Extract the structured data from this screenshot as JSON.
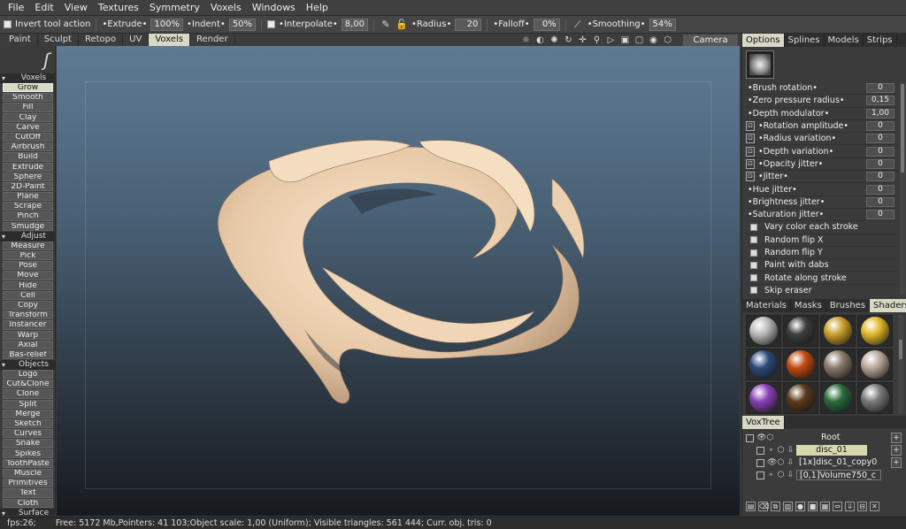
{
  "menu": [
    "File",
    "Edit",
    "View",
    "Textures",
    "Symmetry",
    "Voxels",
    "Windows",
    "Help"
  ],
  "toolopts": {
    "invert": "Invert tool action",
    "extrude_label": "•Extrude•",
    "extrude": "100%",
    "indent_label": "•Indent•",
    "indent": "50%",
    "interp_label": "•Interpolate•",
    "interp": "8,00",
    "radius_label": "•Radius•",
    "radius": "20",
    "falloff_label": "•Falloff•",
    "falloff": "0%",
    "smoothing_label": "•Smoothing•",
    "smoothing": "54%"
  },
  "rooms": [
    "Paint",
    "Sculpt",
    "Retopo",
    "UV",
    "Voxels",
    "Render"
  ],
  "camera": "Camera",
  "left": {
    "voxels_header": "Voxels",
    "voxels": [
      "Grow",
      "Smooth",
      "Fill",
      "Clay",
      "Carve",
      "CutOff",
      "Airbrush",
      "Build",
      "Extrude",
      "Sphere",
      "2D-Paint",
      "Plane",
      "Scrape",
      "Pinch",
      "Smudge"
    ],
    "adjust_header": "Adjust",
    "adjust": [
      "Measure",
      "Pick",
      "Pose",
      "Move",
      "Hide",
      "Cell",
      "Copy",
      "Transform",
      "Instancer",
      "Warp",
      "Axial",
      "Bas-relief"
    ],
    "objects_header": "Objects",
    "objects": [
      "Logo",
      "Cut&Clone",
      "Clone",
      "Split",
      "Merge",
      "Sketch",
      "Curves",
      "Snake",
      "Spikes",
      "ToothPaste",
      "Muscle",
      "Primitives",
      "Text",
      "Cloth"
    ],
    "surface_header": "Surface"
  },
  "right": {
    "tabs": [
      "Options",
      "Splines",
      "Models",
      "Strips"
    ],
    "options": [
      {
        "name": "•Brush rotation•",
        "val": "0",
        "lock": false
      },
      {
        "name": "•Zero pressure radius•",
        "val": "0,15",
        "lock": false
      },
      {
        "name": "•Depth modulator•",
        "val": "1,00",
        "lock": false
      },
      {
        "name": "•Rotation amplitude•",
        "val": "0",
        "lock": true
      },
      {
        "name": "•Radius variation•",
        "val": "0",
        "lock": true
      },
      {
        "name": "•Depth variation•",
        "val": "0",
        "lock": true
      },
      {
        "name": "•Opacity jitter•",
        "val": "0",
        "lock": true
      },
      {
        "name": "•Jitter•",
        "val": "0",
        "lock": true
      },
      {
        "name": "•Hue jitter•",
        "val": "0",
        "lock": false
      },
      {
        "name": "•Brightness jitter•",
        "val": "0",
        "lock": false
      },
      {
        "name": "•Saturation jitter•",
        "val": "0",
        "lock": false
      }
    ],
    "checks": [
      "Vary color each stroke",
      "Random flip X",
      "Random flip Y",
      "Paint with dabs",
      "Rotate along stroke",
      "Skip eraser"
    ],
    "mat_tabs": [
      "Materials",
      "Masks",
      "Brushes",
      "Shaders"
    ],
    "shader_colors": [
      "#b8b8b8",
      "#3e3e3e",
      "#c9a02a",
      "#e2b828",
      "#2a4a7a",
      "#c04a10",
      "#8a7a6a",
      "#b8a898",
      "#8a40b8",
      "#5a3a1a",
      "#2a6a3a",
      "#7a7a7a"
    ],
    "voxtree_tab": "VoxTree",
    "tree": {
      "root": "Root",
      "n1": "disc_01",
      "n2": "[1x]disc_01_copy0",
      "n3": "[0,1]Volume750_c"
    }
  },
  "status": {
    "fps": "fps:26;",
    "info": "Free: 5172 Mb,Pointers: 41 103;Object scale: 1,00 (Uniform); Visible triangles: 561 444; Curr. obj. tris: 0"
  }
}
